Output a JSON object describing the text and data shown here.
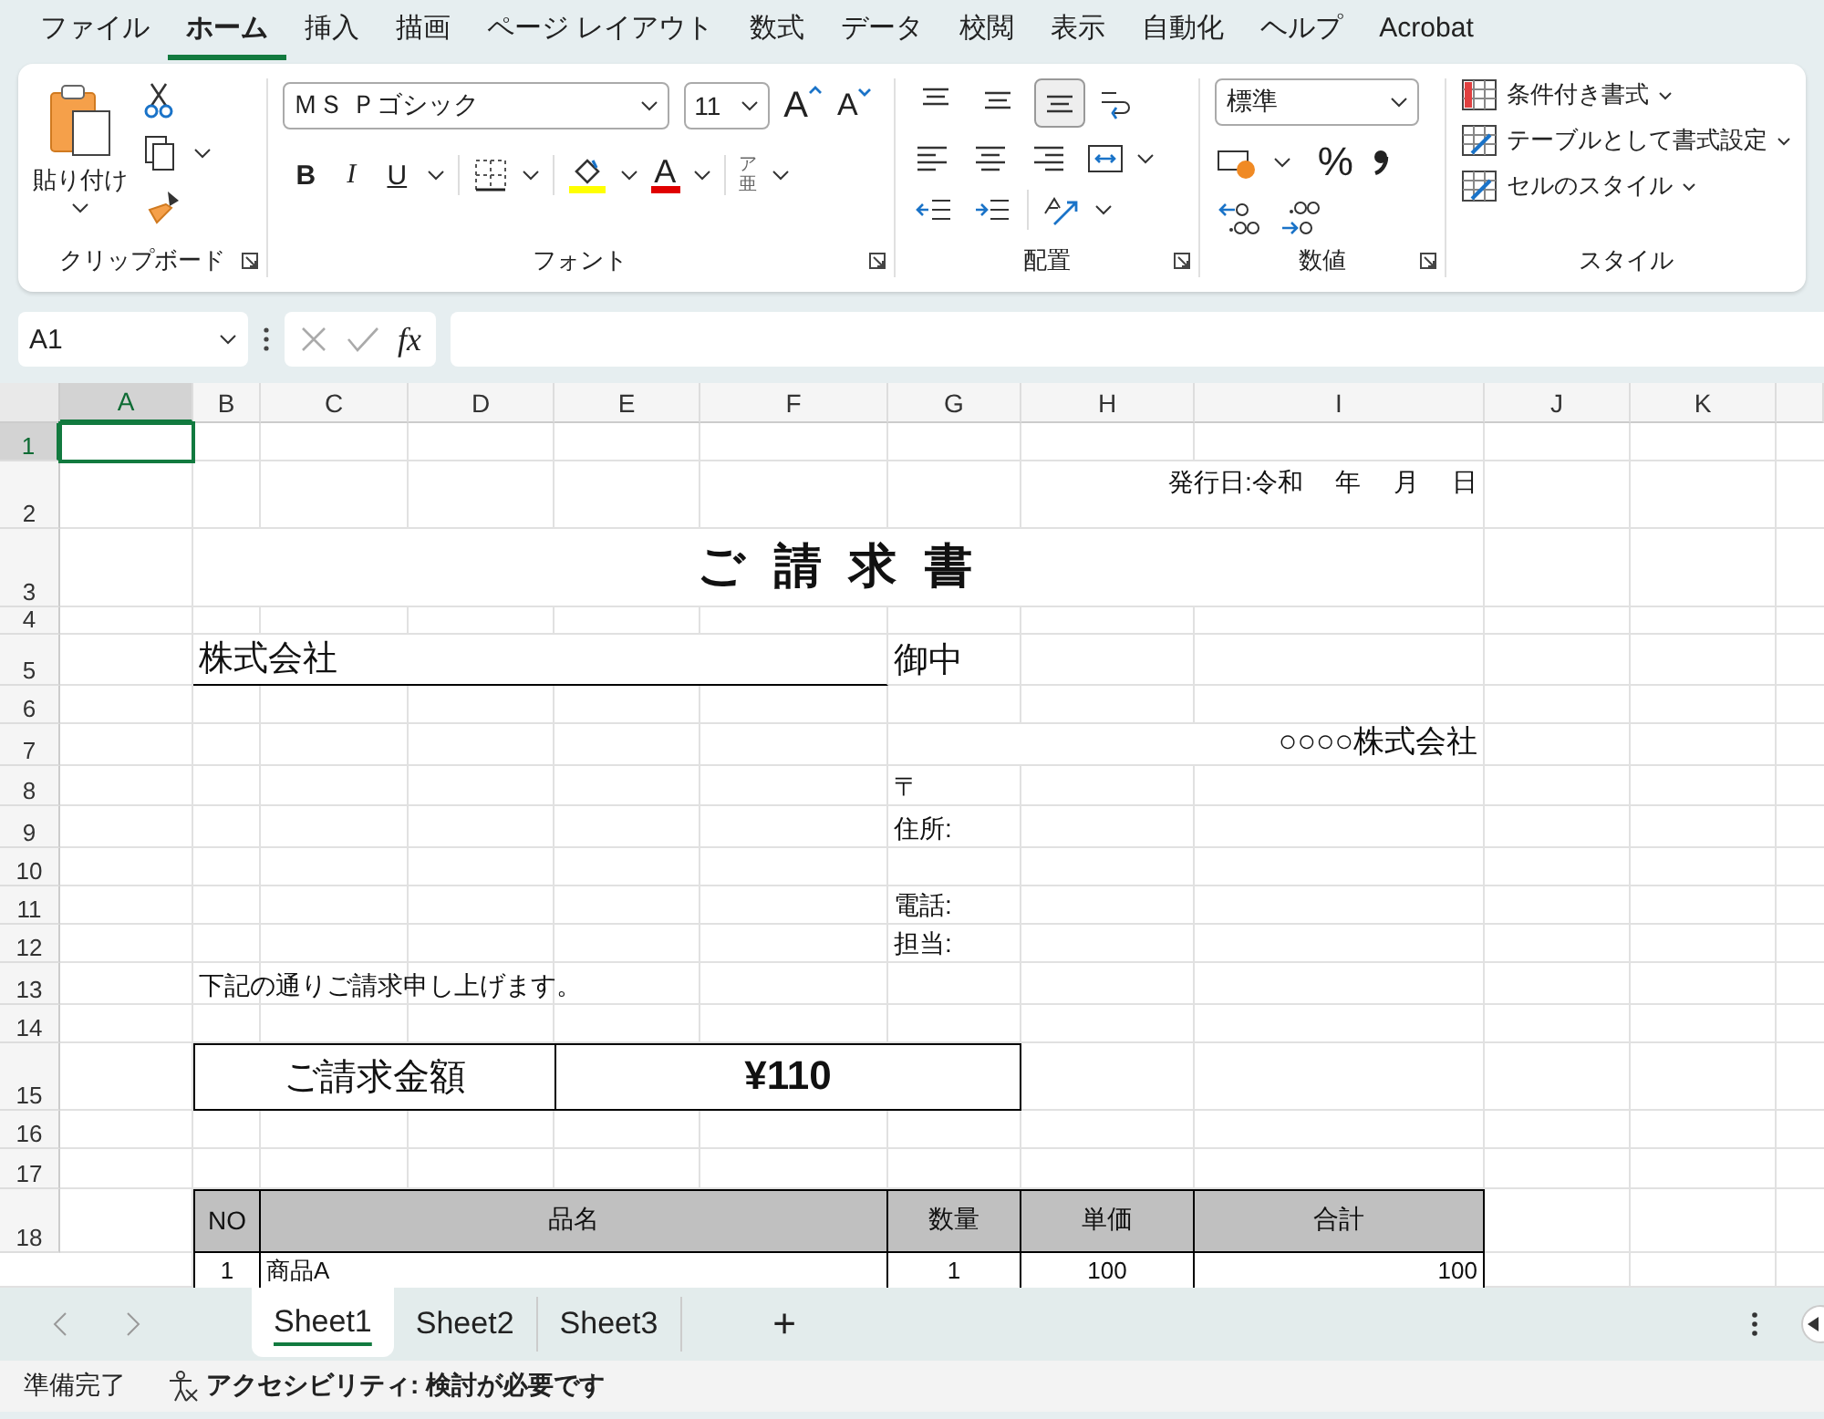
{
  "menu_tabs": [
    {
      "label": "ファイル",
      "selected": false
    },
    {
      "label": "ホーム",
      "selected": true
    },
    {
      "label": "挿入",
      "selected": false
    },
    {
      "label": "描画",
      "selected": false
    },
    {
      "label": "ページ レイアウト",
      "selected": false
    },
    {
      "label": "数式",
      "selected": false
    },
    {
      "label": "データ",
      "selected": false
    },
    {
      "label": "校閲",
      "selected": false
    },
    {
      "label": "表示",
      "selected": false
    },
    {
      "label": "自動化",
      "selected": false
    },
    {
      "label": "ヘルプ",
      "selected": false
    },
    {
      "label": "Acrobat",
      "selected": false
    }
  ],
  "clipboard": {
    "paste": "貼り付け",
    "label": "クリップボード"
  },
  "font": {
    "name": "ＭＳ Ｐゴシック",
    "size": "11",
    "grow": "A",
    "shrink": "A",
    "bold": "B",
    "italic": "I",
    "underline": "U",
    "font_color": "A",
    "phonetic": "ア亜",
    "label": "フォント"
  },
  "alignment": {
    "vertical": [
      {
        "selected": false
      },
      {
        "selected": false
      },
      {
        "selected": true
      }
    ],
    "label": "配置"
  },
  "number": {
    "format": "標準",
    "percent": "%",
    "label": "数値"
  },
  "styles": {
    "buttons": [
      "条件付き書式",
      "テーブルとして書式設定",
      "セルのスタイル"
    ],
    "label": "スタイル"
  },
  "formula_bar": {
    "name_box": "A1",
    "fx": "fx"
  },
  "sheet": {
    "columns": [
      {
        "label": "A",
        "selected": true
      },
      {
        "label": "B",
        "selected": false
      },
      {
        "label": "C",
        "selected": false
      },
      {
        "label": "D",
        "selected": false
      },
      {
        "label": "E",
        "selected": false
      },
      {
        "label": "F",
        "selected": false
      },
      {
        "label": "G",
        "selected": false
      },
      {
        "label": "H",
        "selected": false
      },
      {
        "label": "I",
        "selected": false
      },
      {
        "label": "J",
        "selected": false
      },
      {
        "label": "K",
        "selected": false
      }
    ],
    "rows": [
      {
        "label": "1",
        "selected": true
      },
      {
        "label": "2",
        "selected": false
      },
      {
        "label": "3",
        "selected": false
      },
      {
        "label": "4",
        "selected": false
      },
      {
        "label": "5",
        "selected": false
      },
      {
        "label": "6",
        "selected": false
      },
      {
        "label": "7",
        "selected": false
      },
      {
        "label": "8",
        "selected": false
      },
      {
        "label": "9",
        "selected": false
      },
      {
        "label": "10",
        "selected": false
      },
      {
        "label": "11",
        "selected": false
      },
      {
        "label": "12",
        "selected": false
      },
      {
        "label": "13",
        "selected": false
      },
      {
        "label": "14",
        "selected": false
      },
      {
        "label": "15",
        "selected": false
      },
      {
        "label": "16",
        "selected": false
      },
      {
        "label": "17",
        "selected": false
      },
      {
        "label": "18",
        "selected": false
      }
    ]
  },
  "invoice": {
    "issue_date": "発行日:令和　 年　 月　 日",
    "title": "ご 請 求 書",
    "addressee": "株式会社",
    "honorific": "御中",
    "company": "○○○○株式会社",
    "postal_mark": "〒",
    "address_label": "住所:",
    "phone_label": "電話:",
    "contact_label": "担当:",
    "message": "下記の通りご請求申し上げます。",
    "amount_label": "ご請求金額",
    "amount": "¥110"
  },
  "items_table": {
    "columns": [
      "NO",
      "品名",
      "数量",
      "単価",
      "合計"
    ],
    "rows": [
      [
        "1",
        "商品A",
        "1",
        "100",
        "100"
      ]
    ]
  },
  "sheet_tabs": [
    {
      "label": "Sheet1",
      "selected": true
    },
    {
      "label": "Sheet2",
      "selected": false
    },
    {
      "label": "Sheet3",
      "selected": false
    }
  ],
  "add_sheet": "+",
  "status_bar": {
    "ready": "準備完了",
    "accessibility": "アクセシビリティ: 検討が必要です"
  }
}
